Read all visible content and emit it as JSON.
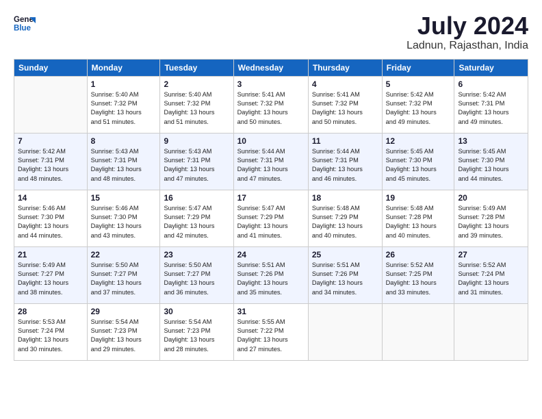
{
  "header": {
    "logo_line1": "General",
    "logo_line2": "Blue",
    "title": "July 2024",
    "subtitle": "Ladnun, Rajasthan, India"
  },
  "days_of_week": [
    "Sunday",
    "Monday",
    "Tuesday",
    "Wednesday",
    "Thursday",
    "Friday",
    "Saturday"
  ],
  "weeks": [
    [
      {
        "day": "",
        "info": ""
      },
      {
        "day": "1",
        "info": "Sunrise: 5:40 AM\nSunset: 7:32 PM\nDaylight: 13 hours\nand 51 minutes."
      },
      {
        "day": "2",
        "info": "Sunrise: 5:40 AM\nSunset: 7:32 PM\nDaylight: 13 hours\nand 51 minutes."
      },
      {
        "day": "3",
        "info": "Sunrise: 5:41 AM\nSunset: 7:32 PM\nDaylight: 13 hours\nand 50 minutes."
      },
      {
        "day": "4",
        "info": "Sunrise: 5:41 AM\nSunset: 7:32 PM\nDaylight: 13 hours\nand 50 minutes."
      },
      {
        "day": "5",
        "info": "Sunrise: 5:42 AM\nSunset: 7:32 PM\nDaylight: 13 hours\nand 49 minutes."
      },
      {
        "day": "6",
        "info": "Sunrise: 5:42 AM\nSunset: 7:31 PM\nDaylight: 13 hours\nand 49 minutes."
      }
    ],
    [
      {
        "day": "7",
        "info": "Sunrise: 5:42 AM\nSunset: 7:31 PM\nDaylight: 13 hours\nand 48 minutes."
      },
      {
        "day": "8",
        "info": "Sunrise: 5:43 AM\nSunset: 7:31 PM\nDaylight: 13 hours\nand 48 minutes."
      },
      {
        "day": "9",
        "info": "Sunrise: 5:43 AM\nSunset: 7:31 PM\nDaylight: 13 hours\nand 47 minutes."
      },
      {
        "day": "10",
        "info": "Sunrise: 5:44 AM\nSunset: 7:31 PM\nDaylight: 13 hours\nand 47 minutes."
      },
      {
        "day": "11",
        "info": "Sunrise: 5:44 AM\nSunset: 7:31 PM\nDaylight: 13 hours\nand 46 minutes."
      },
      {
        "day": "12",
        "info": "Sunrise: 5:45 AM\nSunset: 7:30 PM\nDaylight: 13 hours\nand 45 minutes."
      },
      {
        "day": "13",
        "info": "Sunrise: 5:45 AM\nSunset: 7:30 PM\nDaylight: 13 hours\nand 44 minutes."
      }
    ],
    [
      {
        "day": "14",
        "info": "Sunrise: 5:46 AM\nSunset: 7:30 PM\nDaylight: 13 hours\nand 44 minutes."
      },
      {
        "day": "15",
        "info": "Sunrise: 5:46 AM\nSunset: 7:30 PM\nDaylight: 13 hours\nand 43 minutes."
      },
      {
        "day": "16",
        "info": "Sunrise: 5:47 AM\nSunset: 7:29 PM\nDaylight: 13 hours\nand 42 minutes."
      },
      {
        "day": "17",
        "info": "Sunrise: 5:47 AM\nSunset: 7:29 PM\nDaylight: 13 hours\nand 41 minutes."
      },
      {
        "day": "18",
        "info": "Sunrise: 5:48 AM\nSunset: 7:29 PM\nDaylight: 13 hours\nand 40 minutes."
      },
      {
        "day": "19",
        "info": "Sunrise: 5:48 AM\nSunset: 7:28 PM\nDaylight: 13 hours\nand 40 minutes."
      },
      {
        "day": "20",
        "info": "Sunrise: 5:49 AM\nSunset: 7:28 PM\nDaylight: 13 hours\nand 39 minutes."
      }
    ],
    [
      {
        "day": "21",
        "info": "Sunrise: 5:49 AM\nSunset: 7:27 PM\nDaylight: 13 hours\nand 38 minutes."
      },
      {
        "day": "22",
        "info": "Sunrise: 5:50 AM\nSunset: 7:27 PM\nDaylight: 13 hours\nand 37 minutes."
      },
      {
        "day": "23",
        "info": "Sunrise: 5:50 AM\nSunset: 7:27 PM\nDaylight: 13 hours\nand 36 minutes."
      },
      {
        "day": "24",
        "info": "Sunrise: 5:51 AM\nSunset: 7:26 PM\nDaylight: 13 hours\nand 35 minutes."
      },
      {
        "day": "25",
        "info": "Sunrise: 5:51 AM\nSunset: 7:26 PM\nDaylight: 13 hours\nand 34 minutes."
      },
      {
        "day": "26",
        "info": "Sunrise: 5:52 AM\nSunset: 7:25 PM\nDaylight: 13 hours\nand 33 minutes."
      },
      {
        "day": "27",
        "info": "Sunrise: 5:52 AM\nSunset: 7:24 PM\nDaylight: 13 hours\nand 31 minutes."
      }
    ],
    [
      {
        "day": "28",
        "info": "Sunrise: 5:53 AM\nSunset: 7:24 PM\nDaylight: 13 hours\nand 30 minutes."
      },
      {
        "day": "29",
        "info": "Sunrise: 5:54 AM\nSunset: 7:23 PM\nDaylight: 13 hours\nand 29 minutes."
      },
      {
        "day": "30",
        "info": "Sunrise: 5:54 AM\nSunset: 7:23 PM\nDaylight: 13 hours\nand 28 minutes."
      },
      {
        "day": "31",
        "info": "Sunrise: 5:55 AM\nSunset: 7:22 PM\nDaylight: 13 hours\nand 27 minutes."
      },
      {
        "day": "",
        "info": ""
      },
      {
        "day": "",
        "info": ""
      },
      {
        "day": "",
        "info": ""
      }
    ]
  ]
}
